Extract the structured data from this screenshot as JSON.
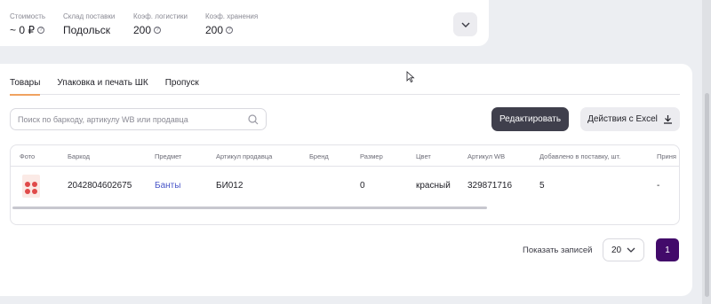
{
  "summary": {
    "cost_label": "Стоимость",
    "cost_value": "~ 0 ₽",
    "warehouse_label": "Склад поставки",
    "warehouse_value": "Подольск",
    "logistics_label": "Коэф. логистики",
    "logistics_value": "200",
    "storage_label": "Коэф. хранения",
    "storage_value": "200"
  },
  "tabs": [
    "Товары",
    "Упаковка и печать ШК",
    "Пропуск"
  ],
  "active_tab": 0,
  "search": {
    "placeholder": "Поиск по баркоду, артикулу WB или продавца"
  },
  "actions": {
    "edit_label": "Редактировать",
    "excel_label": "Действия с Excel"
  },
  "table": {
    "columns": [
      "Фото",
      "Баркод",
      "Предмет",
      "Артикул продавца",
      "Бренд",
      "Размер",
      "Цвет",
      "Артикул WB",
      "Добавлено в поставку, шт.",
      "Приня"
    ],
    "rows": [
      {
        "barcode": "2042804602675",
        "subject": "Банты",
        "seller_article": "БИ012",
        "brand": "",
        "size": "0",
        "color": "красный",
        "wb_article": "329871716",
        "added_qty": "5",
        "accepted": "-"
      }
    ]
  },
  "pagination": {
    "label": "Показать записей",
    "page_size": "20",
    "current_page": "1"
  },
  "colors": {
    "accent_tab": "#f0a260",
    "primary_button": "#3f3f4c",
    "page_active": "#420a6a",
    "link": "#4a57c8"
  }
}
